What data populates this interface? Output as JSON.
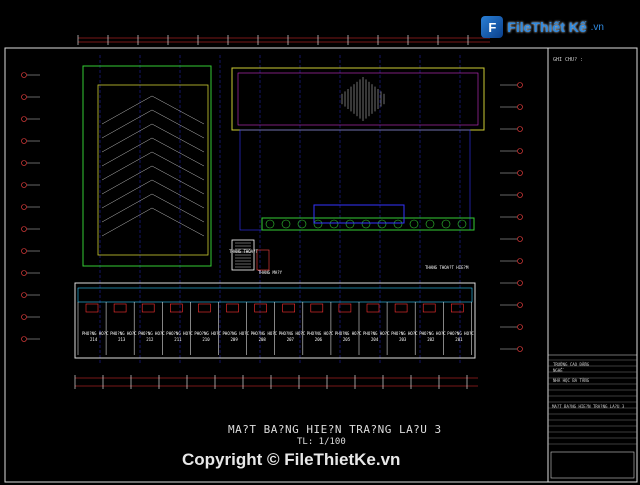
{
  "logo": {
    "mark": "F",
    "text": "FileThiết Kế",
    "suffix": ".vn"
  },
  "drawing": {
    "title": "MA?T BA?NG HIE?N TRA?NG LA?U 3",
    "scale": "TL: 1/100",
    "notes_label": "GHI CHU? :",
    "stair_label": "THANG THOA?T",
    "elevator_label": "THANG MA?Y",
    "exit_stair_label": "THANG THOA?T HIE?M",
    "rooms": [
      {
        "label": "PHO?NG HO?C",
        "number": "214"
      },
      {
        "label": "PHO?NG HO?C",
        "number": "213"
      },
      {
        "label": "PHO?NG HO?C",
        "number": "212"
      },
      {
        "label": "PHO?NG HO?C",
        "number": "211"
      },
      {
        "label": "PHO?NG HO?C",
        "number": "210"
      },
      {
        "label": "PHO?NG HO?C",
        "number": "209"
      },
      {
        "label": "PHO?NG HO?C",
        "number": "208"
      },
      {
        "label": "PHO?NG HO?C",
        "number": "207"
      },
      {
        "label": "PHO?NG HO?C",
        "number": "206"
      },
      {
        "label": "PHO?NG HO?C",
        "number": "205"
      },
      {
        "label": "PHO?NG HO?C",
        "number": "204"
      },
      {
        "label": "PHO?NG HO?C",
        "number": "203"
      },
      {
        "label": "PHO?NG HO?C",
        "number": "202"
      },
      {
        "label": "PHO?NG HO?C",
        "number": "201"
      }
    ]
  },
  "title_block": {
    "owner_line1": "TRƯỜNG CAO ĐẲNG",
    "owner_line2": "NGHỀ",
    "project": "NHÀ HỌC BA TẦNG",
    "sheet_name": "MA?T BA?NG HIE?N TRA?NG LA?U 3"
  },
  "copyright": "Copyright © FileThietKe.vn"
}
